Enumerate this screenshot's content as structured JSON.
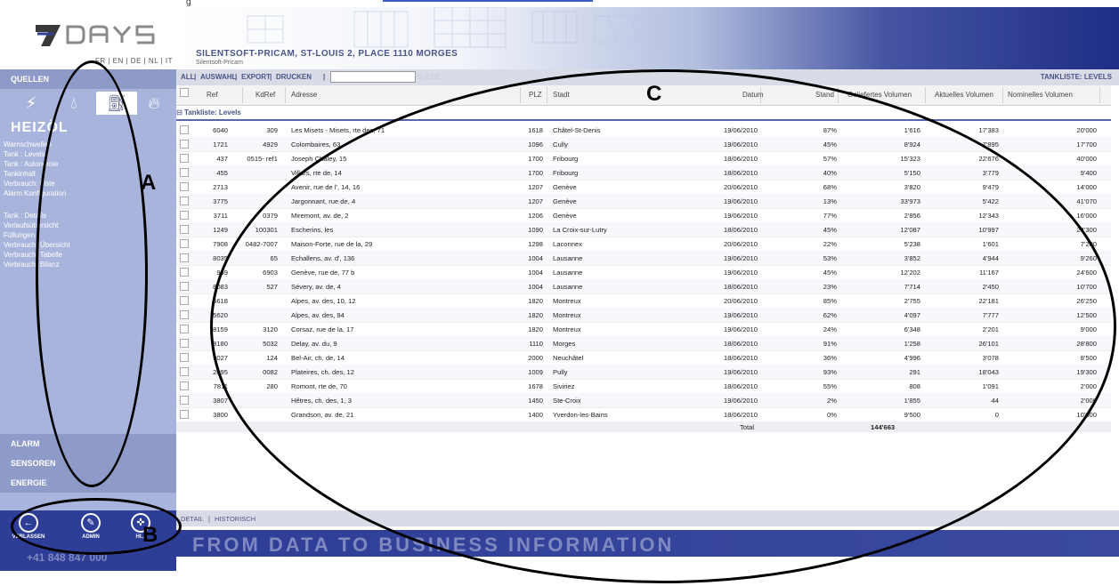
{
  "top_label": "g",
  "logo": {
    "text": "7DAYS",
    "brand_color": "#2e3d96"
  },
  "languages": "FR | EN | DE | NL | IT",
  "banner": {
    "title": "SILENTSOFT-PRICAM, ST-LOUIS 2, PLACE 1110 MORGES",
    "subtitle": "Silentsoft-Pricam"
  },
  "sidebar": {
    "quellen": "QUELLEN",
    "heading": "HEIZÖL",
    "source_icons": [
      "bolt-icon",
      "drop-icon",
      "tank-icon",
      "flame-icon"
    ],
    "items": [
      "Warnschwellen",
      "Tank : Levels",
      "Tank : Autonomie",
      "Tankinhalt",
      "Verbrauch: Liste",
      "Alarm Konfiguration",
      "Tank : Details",
      "Verlaufsübersicht",
      "Füllungen",
      "Verbrauch: Übersicht",
      "Verbrauch: Tabelle",
      "Verbrauch: Bilanz"
    ],
    "bottom_sections": [
      "ALARM",
      "SENSOREN",
      "ENERGIE"
    ]
  },
  "bottom_nav": {
    "verlassen": "VERLASSEN",
    "admin": "ADMIN",
    "help": "HI..."
  },
  "phone": "+41 848 847 000",
  "toolbar": {
    "all": "ALL",
    "sep1": "|",
    "auswahl": "AUSWAHL",
    "sep2": "|",
    "export": "EXPORT",
    "sep3": "|",
    "drucken": "DRUCKEN",
    "sep4": "|",
    "search_value": "",
    "suche": "SUCHE",
    "right_label": "TANKLISTE: LEVELS"
  },
  "table": {
    "headers": {
      "ref": "Ref",
      "kdref": "KdRef",
      "adresse": "Adresse",
      "plz": "PLZ",
      "stadt": "Stadt",
      "datum": "Datum",
      "stand": "Stand",
      "geliefert": "Geliefertes Volumen",
      "aktuell": "Aktuelles Volumen",
      "nominell": "Nominelles Volumen"
    },
    "group_label": "Tankliste: Levels",
    "rows": [
      {
        "ref": "6040",
        "kdref": "309",
        "adresse": "Les Misets - Misets, rte des, 71",
        "plz": "1618",
        "stadt": "Châtel-St-Denis",
        "datum": "19/06/2010",
        "stand": "87%",
        "geliefert": "1'616",
        "aktuell": "17'383",
        "nominell": "20'000"
      },
      {
        "ref": "1721",
        "kdref": "4929",
        "adresse": "Colombaires, 63",
        "plz": "1096",
        "stadt": "Cully",
        "datum": "19/06/2010",
        "stand": "45%",
        "geliefert": "8'924",
        "aktuell": "7'895",
        "nominell": "17'700"
      },
      {
        "ref": "437",
        "kdref": "0515- ref1",
        "adresse": "Joseph Chaley, 15",
        "plz": "1700",
        "stadt": "Fribourg",
        "datum": "18/06/2010",
        "stand": "57%",
        "geliefert": "15'323",
        "aktuell": "22'676",
        "nominell": "40'000"
      },
      {
        "ref": "455",
        "kdref": "",
        "adresse": "Villars, rte de, 14",
        "plz": "1700",
        "stadt": "Fribourg",
        "datum": "18/06/2010",
        "stand": "40%",
        "geliefert": "5'150",
        "aktuell": "3'779",
        "nominell": "9'400"
      },
      {
        "ref": "2713",
        "kdref": "",
        "adresse": "Avenir, rue de l', 14, 16",
        "plz": "1207",
        "stadt": "Genève",
        "datum": "20/06/2010",
        "stand": "68%",
        "geliefert": "3'820",
        "aktuell": "9'479",
        "nominell": "14'000"
      },
      {
        "ref": "3775",
        "kdref": "",
        "adresse": "Jargonnant, rue de, 4",
        "plz": "1207",
        "stadt": "Genève",
        "datum": "19/06/2010",
        "stand": "13%",
        "geliefert": "33'973",
        "aktuell": "5'422",
        "nominell": "41'070"
      },
      {
        "ref": "3711",
        "kdref": "0379",
        "adresse": "Miremont, av. de, 2",
        "plz": "1206",
        "stadt": "Genève",
        "datum": "19/06/2010",
        "stand": "77%",
        "geliefert": "2'856",
        "aktuell": "12'343",
        "nominell": "16'000"
      },
      {
        "ref": "1249",
        "kdref": "100301",
        "adresse": "Escherins, les",
        "plz": "1090",
        "stadt": "La Croix-sur-Lutry",
        "datum": "18/06/2010",
        "stand": "45%",
        "geliefert": "12'087",
        "aktuell": "10'997",
        "nominell": "24'300"
      },
      {
        "ref": "7908",
        "kdref": "0482-7007",
        "adresse": "Maison-Forte, rue de la, 29",
        "plz": "1298",
        "stadt": "Laconnex",
        "datum": "20/06/2010",
        "stand": "22%",
        "geliefert": "5'238",
        "aktuell": "1'601",
        "nominell": "7'200"
      },
      {
        "ref": "8035",
        "kdref": "65",
        "adresse": "Echallens, av. d', 136",
        "plz": "1004",
        "stadt": "Lausanne",
        "datum": "19/06/2010",
        "stand": "53%",
        "geliefert": "3'852",
        "aktuell": "4'944",
        "nominell": "9'260"
      },
      {
        "ref": "959",
        "kdref": "6903",
        "adresse": "Genève, rue de, 77 b",
        "plz": "1004",
        "stadt": "Lausanne",
        "datum": "19/06/2010",
        "stand": "45%",
        "geliefert": "12'202",
        "aktuell": "11'167",
        "nominell": "24'600"
      },
      {
        "ref": "8083",
        "kdref": "527",
        "adresse": "Sévery, av. de, 4",
        "plz": "1004",
        "stadt": "Lausanne",
        "datum": "18/06/2010",
        "stand": "23%",
        "geliefert": "7'714",
        "aktuell": "2'450",
        "nominell": "10'700"
      },
      {
        "ref": "5618",
        "kdref": "",
        "adresse": "Alpes, av. des, 10, 12",
        "plz": "1820",
        "stadt": "Montreux",
        "datum": "20/06/2010",
        "stand": "85%",
        "geliefert": "2'755",
        "aktuell": "22'181",
        "nominell": "26'250"
      },
      {
        "ref": "5620",
        "kdref": "",
        "adresse": "Alpes, av. des, 94",
        "plz": "1820",
        "stadt": "Montreux",
        "datum": "19/06/2010",
        "stand": "62%",
        "geliefert": "4'097",
        "aktuell": "7'777",
        "nominell": "12'500"
      },
      {
        "ref": "8159",
        "kdref": "3120",
        "adresse": "Corsaz, rue de la, 17",
        "plz": "1820",
        "stadt": "Montreux",
        "datum": "19/06/2010",
        "stand": "24%",
        "geliefert": "6'348",
        "aktuell": "2'201",
        "nominell": "9'000"
      },
      {
        "ref": "8180",
        "kdref": "5032",
        "adresse": "Delay, av. du, 9",
        "plz": "1110",
        "stadt": "Morges",
        "datum": "18/06/2010",
        "stand": "91%",
        "geliefert": "1'258",
        "aktuell": "26'101",
        "nominell": "28'800"
      },
      {
        "ref": "9027",
        "kdref": "124",
        "adresse": "Bel-Air, ch. de, 14",
        "plz": "2000",
        "stadt": "Neuchâtel",
        "datum": "18/06/2010",
        "stand": "36%",
        "geliefert": "4'996",
        "aktuell": "3'078",
        "nominell": "8'500"
      },
      {
        "ref": "2095",
        "kdref": "0082",
        "adresse": "Plateires, ch. des, 12",
        "plz": "1009",
        "stadt": "Pully",
        "datum": "19/06/2010",
        "stand": "93%",
        "geliefert": "291",
        "aktuell": "18'043",
        "nominell": "19'300"
      },
      {
        "ref": "7811",
        "kdref": "280",
        "adresse": "Romont, rte de, 70",
        "plz": "1678",
        "stadt": "Siviriez",
        "datum": "18/06/2010",
        "stand": "55%",
        "geliefert": "808",
        "aktuell": "1'091",
        "nominell": "2'000"
      },
      {
        "ref": "3807",
        "kdref": "",
        "adresse": "Hêtres, ch. des, 1, 3",
        "plz": "1450",
        "stadt": "Ste-Croix",
        "datum": "19/06/2010",
        "stand": "2%",
        "geliefert": "1'855",
        "aktuell": "44",
        "nominell": "2'000"
      },
      {
        "ref": "3800",
        "kdref": "",
        "adresse": "Grandson, av. de, 21",
        "plz": "1400",
        "stadt": "Yverdon-les-Bains",
        "datum": "18/06/2010",
        "stand": "0%",
        "geliefert": "9'500",
        "aktuell": "0",
        "nominell": "10'000"
      }
    ],
    "total_label": "Total",
    "total_value": "144'663"
  },
  "bottom_tabs": {
    "detail": "DETAIL",
    "sep": "|",
    "historisch": "HISTORISCH"
  },
  "slogan": "FROM DATA TO BUSINESS INFORMATION",
  "annotations": {
    "a": "A",
    "b": "B",
    "c": "C"
  }
}
